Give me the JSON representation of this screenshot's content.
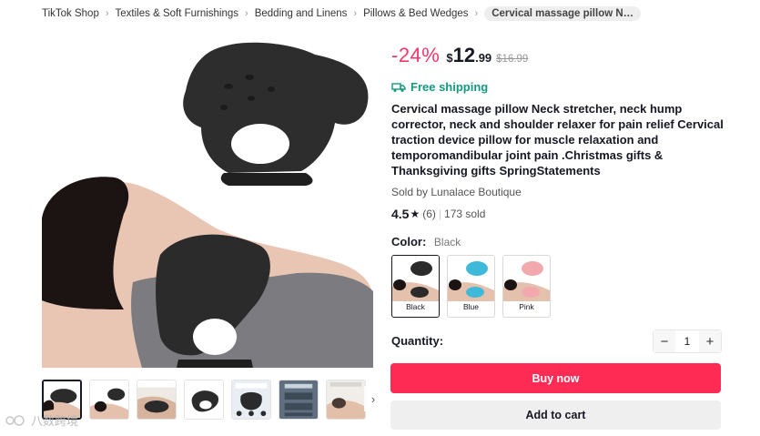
{
  "breadcrumb": {
    "items": [
      "TikTok Shop",
      "Textiles & Soft Furnishings",
      "Bedding and Linens",
      "Pillows & Bed Wedges"
    ],
    "current": "Cervical massage pillow Neck..."
  },
  "product": {
    "discount": "-24%",
    "currency": "$",
    "price_int": "12",
    "price_dec": ".99",
    "original_price": "$16.99",
    "shipping": "Free shipping",
    "title": "Cervical massage pillow Neck stretcher, neck hump corrector, neck and shoulder relaxer for pain relief Cervical traction device pillow for muscle relaxation and temporomandibular joint pain .Christmas gifts & Thanksgiving gifts SpringStatements",
    "seller": "Sold by Lunalace Boutique",
    "rating": "4.5",
    "star_glyph": "★",
    "review_count": "(6)",
    "separator": "|",
    "sold": "173 sold"
  },
  "color": {
    "label": "Color:",
    "selected": "Black",
    "options": [
      {
        "label": "Black",
        "hex": "#2b2b2b"
      },
      {
        "label": "Blue",
        "hex": "#3fb9d9"
      },
      {
        "label": "Pink",
        "hex": "#f2a9ad"
      }
    ]
  },
  "quantity": {
    "label": "Quantity:",
    "value": "1",
    "minus": "−",
    "plus": "+"
  },
  "actions": {
    "buy_now": "Buy now",
    "add_to_cart": "Add to cart"
  },
  "gallery": {
    "next_glyph": "›",
    "thumbnails": [
      {
        "icon": "product-thumb-icon"
      },
      {
        "icon": "product-thumb-icon"
      },
      {
        "icon": "product-thumb-icon"
      },
      {
        "icon": "product-thumb-icon"
      },
      {
        "icon": "product-thumb-icon"
      },
      {
        "icon": "product-thumb-icon"
      },
      {
        "icon": "product-thumb-icon"
      }
    ]
  },
  "watermark": {
    "text": "八数跨境"
  },
  "colors": {
    "accent": "#fe2c55",
    "discount": "#f4366b",
    "shipping": "#139a7e"
  }
}
